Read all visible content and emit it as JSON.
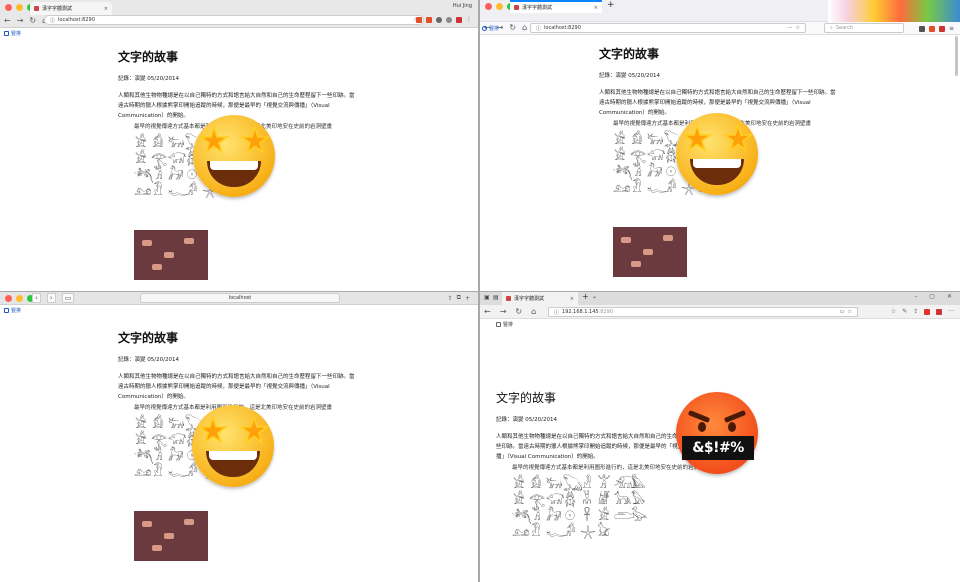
{
  "q1": {
    "tab_title": "漢字字體測試",
    "url": "localhost:8290",
    "user": "Hui Jing"
  },
  "q2": {
    "tab_title": "漢字字體測試",
    "url": "localhost:8290",
    "search_placeholder": "Search"
  },
  "q3": {
    "url": "localhost"
  },
  "q4": {
    "tab_title": "漢字字體測試",
    "url_host": "192.168.1.145",
    "url_port": ":8290"
  },
  "site": {
    "logo": "豎排"
  },
  "article": {
    "title": "文字的故事",
    "meta": "記錄：演變 05/20/2014",
    "para_1": "人類和其他生物物種總是在以自己獨特的方式和語言給大自然和自己的生命歷程留下一些印跡。當遠古時期的獵人根據熊掌印開始追蹤的時候，那便是最早的「視覺交流與傳播」（Visual Communication）的開始。",
    "quote": "最早的視覺傳達方式基本都是利用圖形進行的，這是北美印地安在史前的岩洞壁畫"
  },
  "glyph_set": [
    "𓀀",
    "𓀁",
    "𓃒",
    "𓆏",
    "𓁐",
    "𓀠",
    "𓃰",
    "𓅓",
    "𓀀",
    "𓂀",
    "𓃟",
    "𓆣",
    "𓀡",
    "𓁈",
    "𓃥",
    "𓅃",
    "𓆈",
    "𓀢",
    "𓃗",
    "𓇳",
    "𓋹",
    "𓀀",
    "𓂧",
    "𓅭",
    "𓃭",
    "𓁟",
    "𓆑",
    "𓀔",
    "𓇼",
    "𓃠"
  ],
  "emoji": {
    "star_struck": "star-struck",
    "cursing": "face-with-symbols-on-mouth",
    "curse_text": "&$!#%"
  },
  "colors": {
    "link_blue": "#1a56c4",
    "firefox_tab_blue": "#0a84ff"
  }
}
